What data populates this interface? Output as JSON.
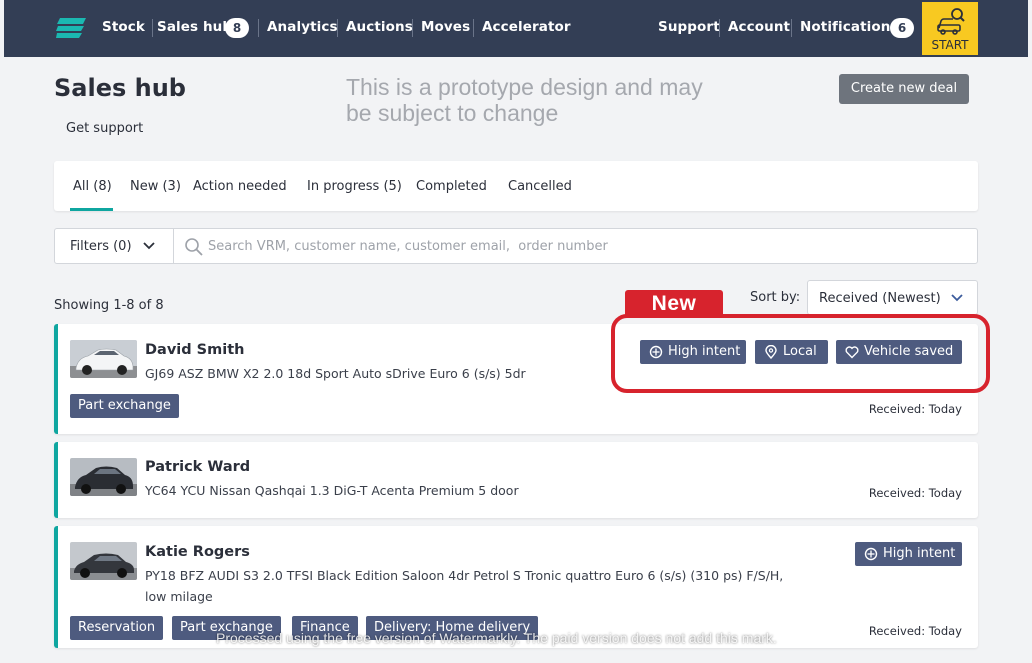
{
  "nav": {
    "items": [
      {
        "label": "Stock"
      },
      {
        "label": "Sales hub",
        "badge": "8"
      },
      {
        "label": "Analytics"
      },
      {
        "label": "Auctions"
      },
      {
        "label": "Moves"
      },
      {
        "label": "Accelerator"
      }
    ],
    "right_items": [
      {
        "label": "Support"
      },
      {
        "label": "Account"
      },
      {
        "label": "Notifications",
        "badge": "6"
      }
    ],
    "start_label": "START",
    "colors": {
      "bar": "#333e55",
      "start": "#f8c921",
      "logo": "#1bb8b1"
    }
  },
  "header": {
    "title": "Sales hub",
    "get_support": "Get support",
    "prototype_note": "This is a prototype design and may be subject to change",
    "create_button": "Create new deal"
  },
  "tabs": [
    {
      "label": "All (8)",
      "active": true
    },
    {
      "label": "New (3)"
    },
    {
      "label": "Action needed"
    },
    {
      "label": "In progress (5)"
    },
    {
      "label": "Completed"
    },
    {
      "label": "Cancelled"
    }
  ],
  "filters": {
    "label": "Filters (0)",
    "search_placeholder": "Search VRM, customer name, customer email,  order number",
    "search_value": ""
  },
  "listing": {
    "showing": "Showing 1-8 of 8",
    "sort_label": "Sort by:",
    "sort_value": "Received (Newest)",
    "new_annotation": "New"
  },
  "deals": [
    {
      "customer": "David Smith",
      "vehicle": "GJ69 ASZ   BMW X2 2.0 18d Sport Auto sDrive Euro 6 (s/s) 5dr",
      "intents": [
        "High intent",
        "Local",
        "Vehicle saved"
      ],
      "tags": [
        "Part exchange"
      ],
      "received": "Received: Today",
      "car_color": "#e9ecef"
    },
    {
      "customer": "Patrick Ward",
      "vehicle": "YC64 YCU   Nissan Qashqai 1.3 DiG-T Acenta Premium 5 door",
      "intents": [],
      "tags": [],
      "received": "Received: Today",
      "car_color": "#2a2d33"
    },
    {
      "customer": "Katie Rogers",
      "vehicle": "PY18 BFZ   AUDI S3 2.0 TFSI Black Edition Saloon 4dr Petrol S Tronic quattro Euro 6 (s/s) (310 ps) F/S/H, low milage",
      "intents": [
        "High intent"
      ],
      "tags": [
        "Reservation",
        "Part exchange",
        "Finance",
        "Delivery: Home delivery"
      ],
      "received": "Received: Today",
      "car_color": "#34373d"
    }
  ],
  "watermark": "Processed using the free version of Watermarkly. The paid version does not add this mark.",
  "colors": {
    "accent": "#0fa6a0",
    "chip": "#4e5b7f",
    "highlight": "#d7232d"
  }
}
